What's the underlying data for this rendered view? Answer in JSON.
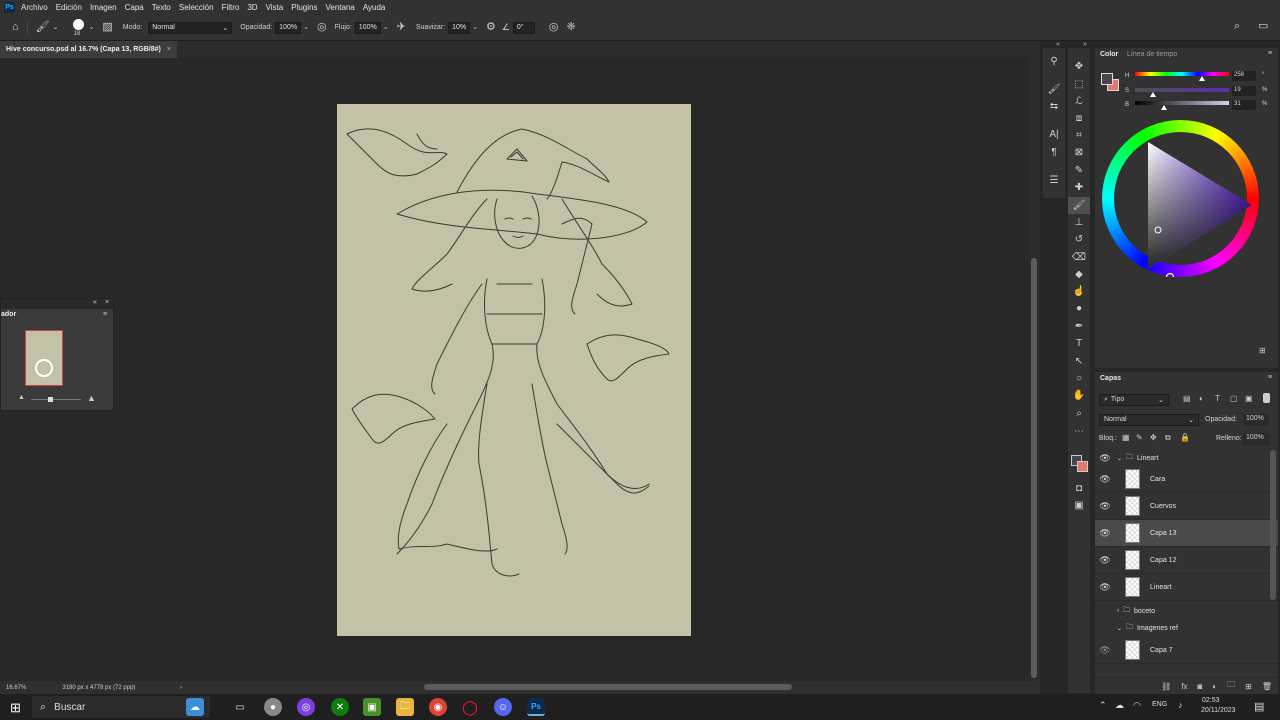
{
  "menubar": {
    "logo": "Ps",
    "items": [
      "Archivo",
      "Edición",
      "Imagen",
      "Capa",
      "Texto",
      "Selección",
      "Filtro",
      "3D",
      "Vista",
      "Plugins",
      "Ventana",
      "Ayuda"
    ]
  },
  "options": {
    "brush_size": "18",
    "mode_label": "Modo:",
    "mode_value": "Normal",
    "opacity_label": "Opacidad:",
    "opacity_value": "100%",
    "flow_label": "Flujo:",
    "flow_value": "100%",
    "smooth_label": "Suavizar:",
    "smooth_value": "10%",
    "angle_value": "0°"
  },
  "document": {
    "tab_title": "Hive concurso.psd al 16.7% (Capa 13, RGB/8#)",
    "close": "×"
  },
  "navigator": {
    "title": "ador"
  },
  "status": {
    "zoom": "16.67%",
    "dimensions": "3180 px x 4778 px (72 ppp)",
    "arrow": "›"
  },
  "color_panel": {
    "tab_active": "Color",
    "tab_other": "Línea de tiempo",
    "h_label": "H",
    "h_value": "258",
    "h_unit": "°",
    "s_label": "S",
    "s_value": "19",
    "s_unit": "%",
    "b_label": "B",
    "b_value": "31",
    "b_unit": "%",
    "hue": 258,
    "saturation_pct": 19,
    "brightness_pct": 31,
    "foreground_color": "#4b4350",
    "background_color": "#e07a6a"
  },
  "layers_panel": {
    "tab": "Capas",
    "filter_label": "Tipo",
    "blend_mode": "Normal",
    "opacity_label": "Opacidad:",
    "opacity_value": "100%",
    "lock_label": "Bloq.:",
    "fill_label": "Relleno:",
    "fill_value": "100%",
    "group_lineart": "Lineart",
    "layers": [
      {
        "name": "Cara",
        "selected": false
      },
      {
        "name": "Cuervos",
        "selected": false
      },
      {
        "name": "Capa 13",
        "selected": true
      },
      {
        "name": "Capa 12",
        "selected": false
      },
      {
        "name": "Lineart",
        "selected": false
      }
    ],
    "group_boceto": "boceto",
    "group_imagenes": "Imagenes ref",
    "layer_capa7": "Capa 7"
  },
  "taskbar": {
    "search_label": "Buscar",
    "language": "ENG",
    "time": "02:53",
    "date": "20/11/2023"
  }
}
